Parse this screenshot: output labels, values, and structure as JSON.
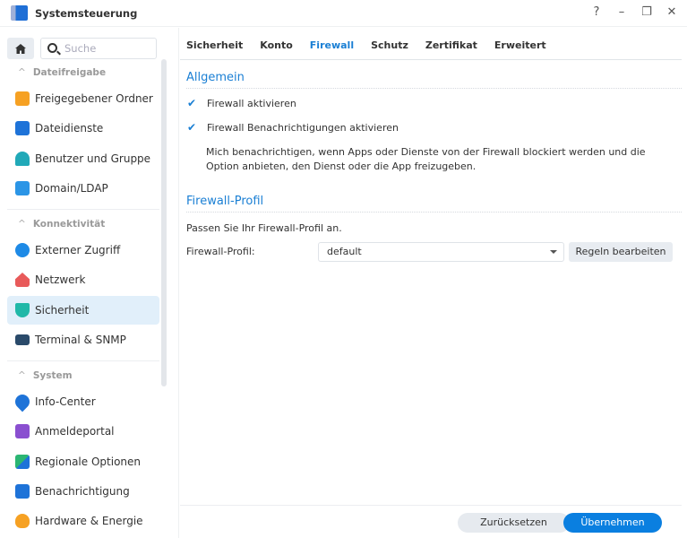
{
  "window": {
    "title": "Systemsteuerung",
    "help": "?",
    "minimize": "–",
    "restore": "❐",
    "close": "✕"
  },
  "sidebar": {
    "search_placeholder": "Suche",
    "groups": [
      {
        "label": "Dateifreigabe",
        "items": [
          "Freigegebener Ordner",
          "Dateidienste",
          "Benutzer und Gruppe",
          "Domain/LDAP"
        ]
      },
      {
        "label": "Konnektivität",
        "items": [
          "Externer Zugriff",
          "Netzwerk",
          "Sicherheit",
          "Terminal & SNMP"
        ]
      },
      {
        "label": "System",
        "items": [
          "Info-Center",
          "Anmeldeportal",
          "Regionale Optionen",
          "Benachrichtigung",
          "Hardware & Energie"
        ]
      }
    ],
    "selected": "Sicherheit"
  },
  "tabs": [
    "Sicherheit",
    "Konto",
    "Firewall",
    "Schutz",
    "Zertifikat",
    "Erweitert"
  ],
  "active_tab": "Firewall",
  "general": {
    "heading": "Allgemein",
    "enable_firewall": {
      "label": "Firewall aktivieren",
      "checked": true
    },
    "enable_notifications": {
      "label": "Firewall Benachrichtigungen aktivieren",
      "checked": true
    },
    "description": "Mich benachrichtigen, wenn Apps oder Dienste von der Firewall blockiert werden und die Option anbieten, den Dienst oder die App freizugeben."
  },
  "profile": {
    "heading": "Firewall-Profil",
    "hint": "Passen Sie Ihr Firewall-Profil an.",
    "label": "Firewall-Profil:",
    "value": "default",
    "edit_rules": "Regeln bearbeiten"
  },
  "footer": {
    "reset": "Zurücksetzen",
    "apply": "Übernehmen"
  },
  "colors": {
    "accent": "#1a7fd4",
    "selected_bg": "#e1effa"
  }
}
